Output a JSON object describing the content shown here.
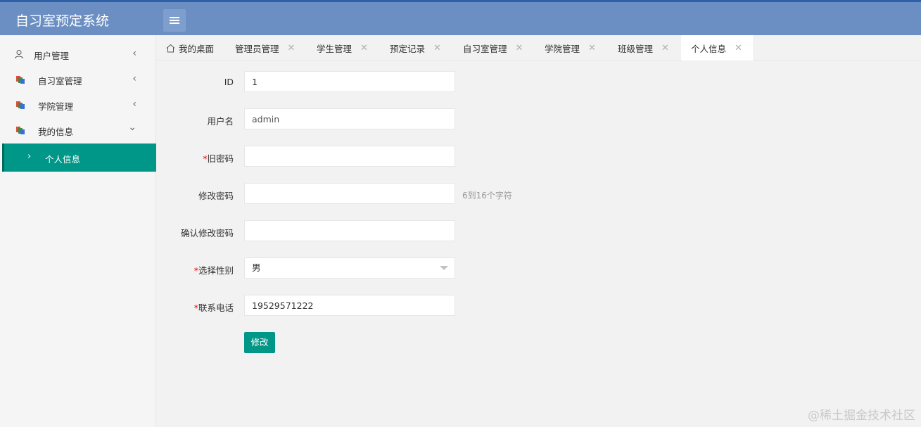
{
  "app": {
    "title": "自习室预定系统"
  },
  "sidebar": {
    "items": [
      {
        "label": "用户管理",
        "icon": "user-icon",
        "arrow": "‹"
      },
      {
        "label": "自习室管理",
        "icon": "folder-icon",
        "arrow": "‹"
      },
      {
        "label": "学院管理",
        "icon": "folder-icon",
        "arrow": "‹"
      },
      {
        "label": "我的信息",
        "icon": "folder-icon",
        "arrow": "⌄"
      }
    ],
    "sub_item": {
      "label": "个人信息",
      "chevron": "›"
    }
  },
  "tabs": [
    {
      "label": "我的桌面",
      "icon": "home-icon",
      "closable": false,
      "active": false
    },
    {
      "label": "管理员管理",
      "closable": true,
      "active": false
    },
    {
      "label": "学生管理",
      "closable": true,
      "active": false
    },
    {
      "label": "预定记录",
      "closable": true,
      "active": false
    },
    {
      "label": "自习室管理",
      "closable": true,
      "active": false
    },
    {
      "label": "学院管理",
      "closable": true,
      "active": false
    },
    {
      "label": "班级管理",
      "closable": true,
      "active": false
    },
    {
      "label": "个人信息",
      "closable": true,
      "active": true
    }
  ],
  "tab_close_glyph": "✕",
  "form": {
    "id": {
      "label": "ID",
      "value": "1"
    },
    "username": {
      "label": "用户名",
      "value": "admin"
    },
    "old_password": {
      "required_mark": "*",
      "label": "旧密码",
      "value": ""
    },
    "new_password": {
      "label": "修改密码",
      "value": "",
      "hint": "6到16个字符"
    },
    "confirm_password": {
      "label": "确认修改密码",
      "value": ""
    },
    "gender": {
      "required_mark": "*",
      "label": "选择性别",
      "value": "男"
    },
    "phone": {
      "required_mark": "*",
      "label": "联系电话",
      "value": "19529571222"
    },
    "submit_label": "修改"
  },
  "watermark": "@稀土掘金技术社区",
  "colors": {
    "topbar": "#6b8fc2",
    "accent": "#009688",
    "required": "#ee0000"
  }
}
